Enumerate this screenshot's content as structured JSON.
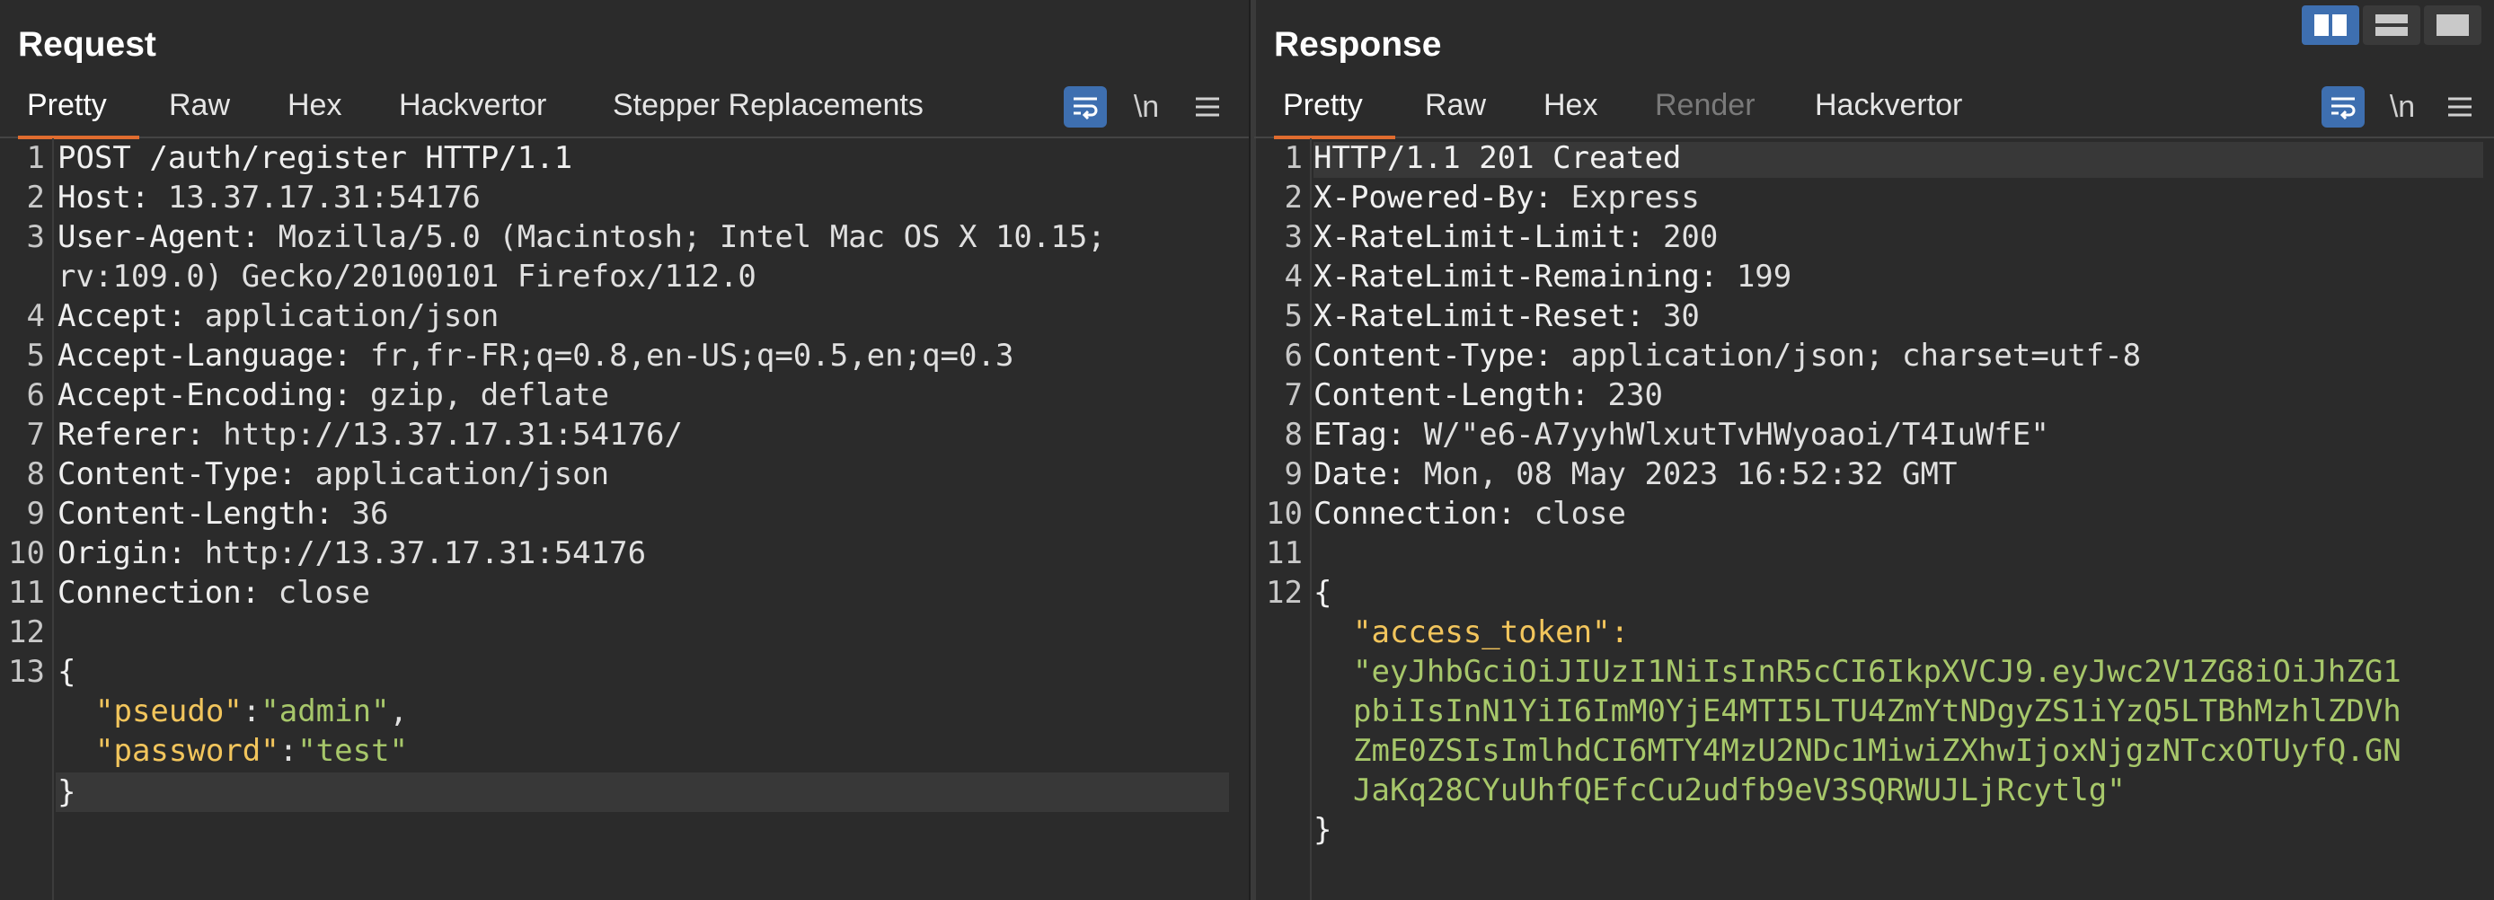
{
  "request": {
    "title": "Request",
    "tabs": [
      "Pretty",
      "Raw",
      "Hex",
      "Hackvertor",
      "Stepper Replacements"
    ],
    "lines": [
      {
        "n": "1",
        "k": "POST /auth/register HTTP/1.1",
        "v": ""
      },
      {
        "n": "2",
        "k": "Host:",
        "v": " 13.37.17.31:54176"
      },
      {
        "n": "3",
        "k": "User-Agent:",
        "v": " Mozilla/5.0 (Macintosh; Intel Mac OS X 10.15;"
      },
      {
        "n": "",
        "k": "",
        "v": "rv:109.0) Gecko/20100101 Firefox/112.0"
      },
      {
        "n": "4",
        "k": "Accept:",
        "v": " application/json"
      },
      {
        "n": "5",
        "k": "Accept-Language:",
        "v": " fr,fr-FR;q=0.8,en-US;q=0.5,en;q=0.3"
      },
      {
        "n": "6",
        "k": "Accept-Encoding:",
        "v": " gzip, deflate"
      },
      {
        "n": "7",
        "k": "Referer:",
        "v": " http://13.37.17.31:54176/"
      },
      {
        "n": "8",
        "k": "Content-Type:",
        "v": " application/json"
      },
      {
        "n": "9",
        "k": "Content-Length:",
        "v": " 36"
      },
      {
        "n": "10",
        "k": "Origin:",
        "v": " http://13.37.17.31:54176"
      },
      {
        "n": "11",
        "k": "Connection:",
        "v": " close"
      },
      {
        "n": "12",
        "k": "",
        "v": ""
      },
      {
        "n": "13",
        "k": "{",
        "v": ""
      }
    ],
    "json": [
      {
        "key": "\"pseudo\"",
        "sep": ":",
        "val": "\"admin\"",
        "tail": ","
      },
      {
        "key": "\"password\"",
        "sep": ":",
        "val": "\"test\"",
        "tail": ""
      }
    ],
    "close_brace": "}"
  },
  "response": {
    "title": "Response",
    "tabs": [
      "Pretty",
      "Raw",
      "Hex",
      "Render",
      "Hackvertor"
    ],
    "lines": [
      {
        "n": "1",
        "k": "HTTP/1.1 201 Created",
        "v": ""
      },
      {
        "n": "2",
        "k": "X-Powered-By:",
        "v": " Express"
      },
      {
        "n": "3",
        "k": "X-RateLimit-Limit:",
        "v": " 200"
      },
      {
        "n": "4",
        "k": "X-RateLimit-Remaining:",
        "v": " 199"
      },
      {
        "n": "5",
        "k": "X-RateLimit-Reset:",
        "v": " 30"
      },
      {
        "n": "6",
        "k": "Content-Type:",
        "v": " application/json; charset=utf-8"
      },
      {
        "n": "7",
        "k": "Content-Length:",
        "v": " 230"
      },
      {
        "n": "8",
        "k": "ETag:",
        "v": " W/\"e6-A7yyhWlxutTvHWyoaoi/T4IuWfE\""
      },
      {
        "n": "9",
        "k": "Date:",
        "v": " Mon, 08 May 2023 16:52:32 GMT"
      },
      {
        "n": "10",
        "k": "Connection:",
        "v": " close"
      },
      {
        "n": "11",
        "k": "",
        "v": ""
      },
      {
        "n": "12",
        "k": "{",
        "v": ""
      }
    ],
    "token_key": "\"access_token\":",
    "token_lines": [
      "\"eyJhbGciOiJIUzI1NiIsInR5cCI6IkpXVCJ9.eyJwc2V1ZG8iOiJhZG1",
      "pbiIsInN1YiI6ImM0YjE4MTI5LTU4ZmYtNDgyZS1iYzQ5LTBhMzhlZDVh",
      "ZmE0ZSIsImlhdCI6MTY4MzU2NDc1MiwiZXhwIjoxNjgzNTcxOTUyfQ.GN",
      "JaKq28CYuUhfQEfcCu2udfb9eV3SQRWUJLjRcytlg\""
    ],
    "close_brace": "}"
  },
  "toolbar": {
    "wrap_icon": "word-wrap-icon",
    "newline_label": "\\n",
    "menu_icon": "hamburger-menu-icon"
  },
  "colors": {
    "accent": "#3e6fb0",
    "tab_underline": "#e06c2f",
    "json_key": "#f2c55c",
    "json_string": "#a7c76a"
  }
}
